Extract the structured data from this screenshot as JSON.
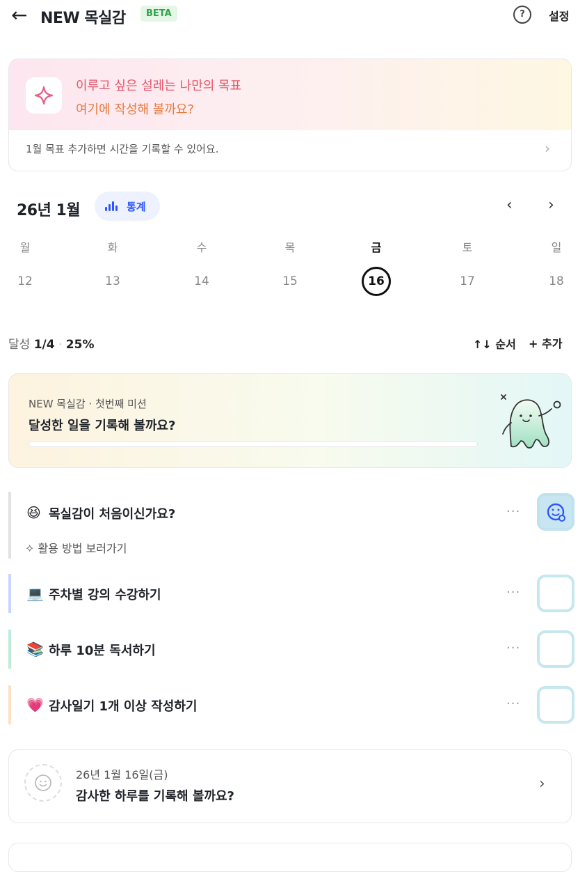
{
  "header": {
    "back_icon": "arrow-left-icon",
    "title": "NEW 목실감",
    "badge": "BETA",
    "help_icon": "question-icon",
    "settings_label": "설정"
  },
  "goal_card": {
    "icon": "sparkle-icon",
    "line1": "이루고 싶은 설레는 나만의 목표",
    "line2": "여기에 작성해 볼까요?",
    "footer": "1월 목표  추가하면 시간을 기록할 수 있어요.",
    "colors": {
      "line1": "#e6576a",
      "line2": "#e77a3f"
    }
  },
  "calendar": {
    "month_label": "26년 1월",
    "stats_label": "통계",
    "weekdays": [
      "월",
      "화",
      "수",
      "목",
      "금",
      "토",
      "일"
    ],
    "days": [
      "12",
      "13",
      "14",
      "15",
      "16",
      "17",
      "18"
    ],
    "selected_day": "16"
  },
  "progress": {
    "prefix": "달성 ",
    "count": "1/4",
    "sep": " · ",
    "percent": "25%",
    "order_label": "↑↓ 순서",
    "add_label": "+ 추가"
  },
  "mission": {
    "subtitle": "NEW 목실감 · 첫번째 미션",
    "title": "달성한 일을 기록해 볼까요?",
    "progress": 0
  },
  "tasks": [
    {
      "emoji": "😆",
      "label": "목실감이 처음이신가요?",
      "accent": "#e2e2e2",
      "checked": true
    },
    {
      "emoji": "💻",
      "label": "주차별 강의 수강하기",
      "accent": "#c8d6ff",
      "checked": false
    },
    {
      "emoji": "📚",
      "label": "하루 10분 독서하기",
      "accent": "#bdecd9",
      "checked": false
    },
    {
      "emoji": "💗",
      "label": "감사일기 1개 이상 작성하기",
      "accent": "#fde0c4",
      "checked": false
    }
  ],
  "guide_link": "✧ 활용 방법 보러가기",
  "more_label": "···",
  "diary": {
    "date": "26년 1월 16일(금)",
    "title": "감사한 하루를 기록해 볼까요?"
  }
}
